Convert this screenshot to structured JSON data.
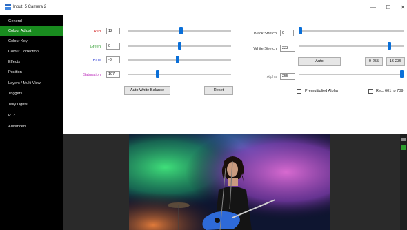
{
  "window": {
    "title": "Input: 5 Camera 2",
    "controls": [
      "—",
      "☐",
      "✕"
    ]
  },
  "sidebar": {
    "items": [
      {
        "label": "General",
        "active": false
      },
      {
        "label": "Colour Adjust",
        "active": true
      },
      {
        "label": "Colour Key",
        "active": false
      },
      {
        "label": "Colour Correction",
        "active": false
      },
      {
        "label": "Effects",
        "active": false
      },
      {
        "label": "Position",
        "active": false
      },
      {
        "label": "Layers / Multi View",
        "active": false
      },
      {
        "label": "Triggers",
        "active": false
      },
      {
        "label": "Tally Lights",
        "active": false
      },
      {
        "label": "PTZ",
        "active": false
      },
      {
        "label": "Advanced",
        "active": false
      }
    ],
    "active_color": "#198c1f"
  },
  "colour_adjust": {
    "red": {
      "label": "Red",
      "value": "12",
      "level": 0.52,
      "color": "#d42a2a"
    },
    "green": {
      "label": "Green",
      "value": "0",
      "level": 0.5,
      "color": "#2a9a2a"
    },
    "blue": {
      "label": "Blue",
      "value": "-8",
      "level": 0.48,
      "color": "#2a3ad4"
    },
    "saturation": {
      "label": "Saturation",
      "value": "107",
      "level": 0.28,
      "color": "#c03ac0"
    },
    "auto_white_balance_label": "Auto White Balance",
    "reset_label": "Reset"
  },
  "levels": {
    "black_stretch": {
      "label": "Black Stretch",
      "value": "0",
      "level": 0.0
    },
    "white_stretch": {
      "label": "White Stretch",
      "value": "223",
      "level": 0.88
    },
    "auto_label": "Auto",
    "range_full_label": "0-255",
    "range_video_label": "16-235",
    "alpha": {
      "label": "Alpha",
      "value": "255",
      "level": 1.0
    },
    "premultiplied_alpha_label": "Premultiplied Alpha",
    "rec_label": "Rec. 601 to 709",
    "slider_color": "#0a6fd8"
  },
  "preview": {
    "description_icon": "concert-performer-image"
  }
}
